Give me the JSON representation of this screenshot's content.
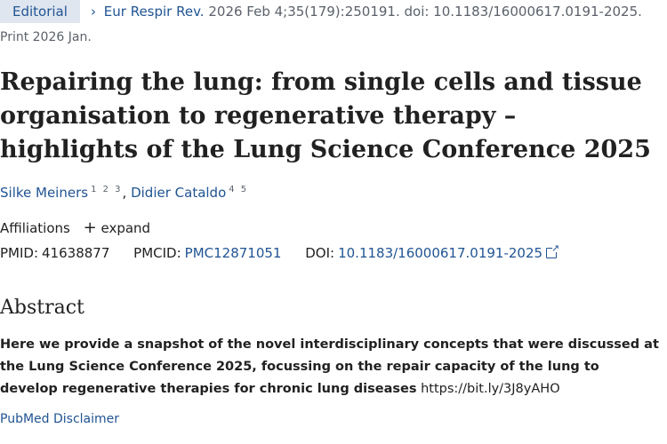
{
  "article_type": "Editorial",
  "citation": {
    "journal": "Eur Respir Rev.",
    "details": "2026 Feb 4;35(179):250191. doi: 10.1183/16000617.0191-2025.",
    "print": "Print 2026 Jan."
  },
  "title": "Repairing the lung: from single cells and tissue organisation to regenerative therapy – highlights of the Lung Science Conference 2025",
  "authors": [
    {
      "name": "Silke Meiners",
      "affils": "1 2 3"
    },
    {
      "name": "Didier Cataldo",
      "affils": "4 5"
    }
  ],
  "author_separator": ",",
  "affiliations": {
    "label": "Affiliations",
    "expand": "expand"
  },
  "ids": {
    "pmid_label": "PMID:",
    "pmid": "41638877",
    "pmcid_label": "PMCID:",
    "pmcid": "PMC12871051",
    "doi_label": "DOI:",
    "doi": "10.1183/16000617.0191-2025"
  },
  "abstract": {
    "heading": "Abstract",
    "bold_text": "Here we provide a snapshot of the novel interdisciplinary concepts that were discussed at the Lung Science Conference 2025, focussing on the repair capacity of the lung to develop regenerative therapies for chronic lung diseases",
    "link_text": "https://bit.ly/3J8yAHO"
  },
  "disclaimer": "PubMed Disclaimer",
  "colors": {
    "link": "#205493",
    "tag_bg": "#dfe6ef",
    "text": "#212121",
    "muted": "#5b616b"
  }
}
